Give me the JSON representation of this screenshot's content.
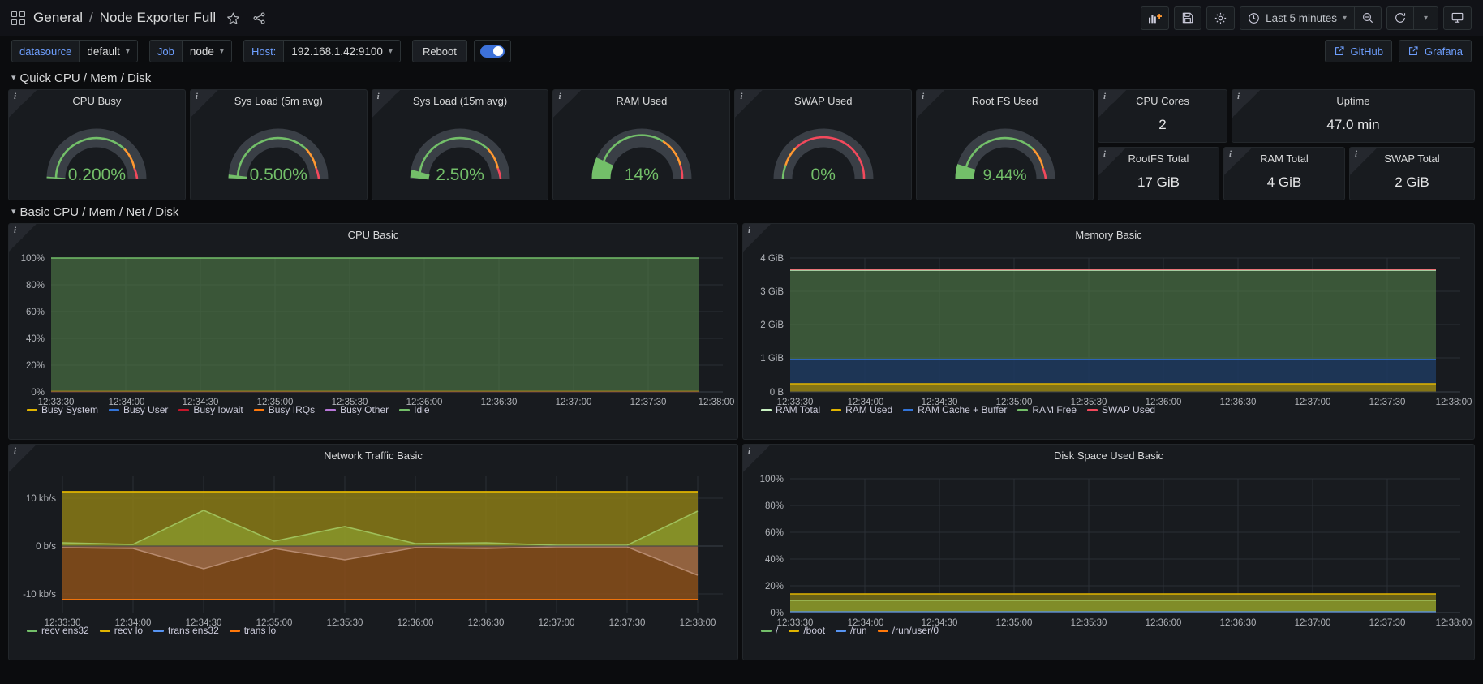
{
  "nav": {
    "grid_icon": "dashboards-grid-icon",
    "breadcrumb_folder": "General",
    "breadcrumb_sep": "/",
    "breadcrumb_dashboard": "Node Exporter Full",
    "star_icon": "star-icon",
    "share_icon": "share-icon",
    "add_panel_icon": "add-panel-icon",
    "save_icon": "save-icon",
    "settings_icon": "gear-icon",
    "clock_icon": "clock-icon",
    "time_range": "Last 5 minutes",
    "time_chevron": "chevron-down-icon",
    "zoom_out_icon": "zoom-out-icon",
    "refresh_icon": "refresh-icon",
    "refresh_chevron": "chevron-down-icon",
    "tv_icon": "tv-kiosk-icon"
  },
  "variables": {
    "datasource": {
      "label": "datasource",
      "value": "default",
      "chevron": "chevron-down-icon"
    },
    "job": {
      "label": "Job",
      "value": "node",
      "chevron": "chevron-down-icon"
    },
    "host": {
      "label": "Host:",
      "value": "192.168.1.42:9100",
      "chevron": "chevron-down-icon"
    },
    "reboot": {
      "label": "Reboot",
      "toggle_on": true
    },
    "links": [
      {
        "label": "GitHub",
        "icon": "external-link-icon"
      },
      {
        "label": "Grafana",
        "icon": "external-link-icon"
      }
    ]
  },
  "sections": [
    {
      "title": "Quick CPU / Mem / Disk",
      "chevron": "chevron-down-icon",
      "collapsed": false
    },
    {
      "title": "Basic CPU / Mem / Net / Disk",
      "chevron": "chevron-down-icon",
      "collapsed": false
    }
  ],
  "gauges": [
    {
      "title": "CPU Busy",
      "value": "0.200%",
      "pct": 0.2,
      "color": "#73bf69"
    },
    {
      "title": "Sys Load (5m avg)",
      "value": "0.500%",
      "pct": 0.5,
      "color": "#73bf69"
    },
    {
      "title": "Sys Load (15m avg)",
      "value": "2.50%",
      "pct": 2.5,
      "color": "#73bf69"
    },
    {
      "title": "RAM Used",
      "value": "14%",
      "pct": 14,
      "color": "#73bf69"
    },
    {
      "title": "SWAP Used",
      "value": "0%",
      "pct": 0,
      "color": "#73bf69"
    },
    {
      "title": "Root FS Used",
      "value": "9.44%",
      "pct": 9.44,
      "color": "#73bf69"
    }
  ],
  "stats": [
    {
      "title": "CPU Cores",
      "value": "2"
    },
    {
      "title": "Uptime",
      "value": "47.0 min"
    },
    {
      "title": "RootFS Total",
      "value": "17 GiB"
    },
    {
      "title": "RAM Total",
      "value": "4 GiB"
    },
    {
      "title": "SWAP Total",
      "value": "2 GiB"
    }
  ],
  "chart_data": [
    {
      "type": "area",
      "title": "CPU Basic",
      "xlabel": "",
      "ylabel": "",
      "ylim": [
        0,
        100
      ],
      "yticks": [
        "0%",
        "20%",
        "40%",
        "60%",
        "80%",
        "100%"
      ],
      "grid": true,
      "legend_position": "bottom",
      "x": [
        "12:33:30",
        "12:34:00",
        "12:34:30",
        "12:35:00",
        "12:35:30",
        "12:36:00",
        "12:36:30",
        "12:37:00",
        "12:37:30",
        "12:38:00"
      ],
      "series": [
        {
          "name": "Busy System",
          "color": "#e0b400",
          "values": [
            0.1,
            0.1,
            0.1,
            0.1,
            0.1,
            0.1,
            0.1,
            0.1,
            0.1,
            0.1
          ]
        },
        {
          "name": "Busy User",
          "color": "#3274d9",
          "values": [
            0.1,
            0.1,
            0.1,
            0.1,
            0.1,
            0.1,
            0.1,
            0.1,
            0.1,
            0.1
          ]
        },
        {
          "name": "Busy Iowait",
          "color": "#c4162a",
          "values": [
            0,
            0,
            0,
            0,
            0,
            0,
            0,
            0,
            0,
            0
          ]
        },
        {
          "name": "Busy IRQs",
          "color": "#ff780a",
          "values": [
            0,
            0,
            0,
            0,
            0,
            0,
            0,
            0,
            0,
            0
          ]
        },
        {
          "name": "Busy Other",
          "color": "#b877d9",
          "values": [
            0,
            0,
            0,
            0,
            0,
            0,
            0,
            0,
            0,
            0
          ]
        },
        {
          "name": "Idle",
          "color": "#73bf69",
          "values": [
            99.8,
            99.8,
            99.8,
            99.8,
            99.8,
            99.8,
            99.8,
            99.8,
            99.8,
            99.8
          ]
        }
      ]
    },
    {
      "type": "area",
      "title": "Memory Basic",
      "xlabel": "",
      "ylabel": "",
      "ylim": [
        0,
        4
      ],
      "yticks": [
        "0 B",
        "1 GiB",
        "2 GiB",
        "3 GiB",
        "4 GiB"
      ],
      "grid": true,
      "legend_position": "bottom",
      "x": [
        "12:33:30",
        "12:34:00",
        "12:34:30",
        "12:35:00",
        "12:35:30",
        "12:36:00",
        "12:36:30",
        "12:37:00",
        "12:37:30",
        "12:38:00"
      ],
      "series": [
        {
          "name": "RAM Total",
          "color": "#c8f2c2",
          "values": [
            3.85,
            3.85,
            3.85,
            3.85,
            3.85,
            3.85,
            3.85,
            3.85,
            3.85,
            3.85
          ]
        },
        {
          "name": "RAM Used",
          "color": "#e0b400",
          "values": [
            0.26,
            0.26,
            0.26,
            0.26,
            0.26,
            0.26,
            0.26,
            0.26,
            0.26,
            0.26
          ]
        },
        {
          "name": "RAM Cache + Buffer",
          "color": "#3274d9",
          "values": [
            0.85,
            0.85,
            0.85,
            0.85,
            0.85,
            0.85,
            0.85,
            0.85,
            0.85,
            0.85
          ]
        },
        {
          "name": "RAM Free",
          "color": "#73bf69",
          "values": [
            2.57,
            2.57,
            2.57,
            2.57,
            2.57,
            2.57,
            2.57,
            2.57,
            2.57,
            2.57
          ]
        },
        {
          "name": "SWAP Used",
          "color": "#f2495c",
          "values": [
            0,
            0,
            0,
            0,
            0,
            0,
            0,
            0,
            0,
            0
          ]
        }
      ]
    },
    {
      "type": "area",
      "title": "Network Traffic Basic",
      "xlabel": "",
      "ylabel": "",
      "ylim": [
        -13,
        13
      ],
      "yticks": [
        "-10 kb/s",
        "0 b/s",
        "10 kb/s"
      ],
      "grid": true,
      "legend_position": "bottom",
      "x": [
        "12:33:30",
        "12:34:00",
        "12:34:30",
        "12:35:00",
        "12:35:30",
        "12:36:00",
        "12:36:30",
        "12:37:00",
        "12:37:30",
        "12:38:00"
      ],
      "series": [
        {
          "name": "recv ens32",
          "color": "#73bf69",
          "values": [
            0.8,
            0.4,
            8.6,
            1.2,
            0.6,
            0.4,
            0.2,
            0.1,
            0.2,
            8.4
          ]
        },
        {
          "name": "recv lo",
          "color": "#e0b400",
          "values": [
            11.3,
            11.3,
            11.3,
            11.3,
            11.3,
            11.3,
            11.3,
            11.3,
            11.3,
            11.3
          ]
        },
        {
          "name": "trans ens32",
          "color": "#5794f2",
          "values": [
            -0.4,
            -0.3,
            -5.4,
            -0.5,
            -3.2,
            -0.3,
            -0.4,
            -0.2,
            -0.2,
            -7.3
          ]
        },
        {
          "name": "trans lo",
          "color": "#ff780a",
          "values": [
            -12.0,
            -12.0,
            -12.0,
            -12.0,
            -12.0,
            -12.0,
            -12.0,
            -12.0,
            -12.0,
            -12.0
          ]
        }
      ]
    },
    {
      "type": "area",
      "title": "Disk Space Used Basic",
      "xlabel": "",
      "ylabel": "",
      "ylim": [
        0,
        100
      ],
      "yticks": [
        "0%",
        "20%",
        "40%",
        "60%",
        "80%",
        "100%"
      ],
      "grid": true,
      "legend_position": "bottom",
      "x": [
        "12:33:30",
        "12:34:00",
        "12:34:30",
        "12:35:00",
        "12:35:30",
        "12:36:00",
        "12:36:30",
        "12:37:00",
        "12:37:30",
        "12:38:00"
      ],
      "series": [
        {
          "name": "/",
          "color": "#73bf69",
          "values": [
            9.4,
            9.4,
            9.4,
            9.4,
            9.4,
            9.4,
            9.4,
            9.4,
            9.4,
            9.4
          ]
        },
        {
          "name": "/boot",
          "color": "#e0b400",
          "values": [
            14.0,
            14.0,
            14.0,
            14.0,
            14.0,
            14.0,
            14.0,
            14.0,
            14.0,
            14.0
          ]
        },
        {
          "name": "/run",
          "color": "#5794f2",
          "values": [
            0.5,
            0.5,
            0.5,
            0.5,
            0.5,
            0.5,
            0.5,
            0.5,
            0.5,
            0.5
          ]
        },
        {
          "name": "/run/user/0",
          "color": "#ff780a",
          "values": [
            0,
            0,
            0,
            0,
            0,
            0,
            0,
            0,
            0,
            0
          ]
        }
      ]
    }
  ]
}
